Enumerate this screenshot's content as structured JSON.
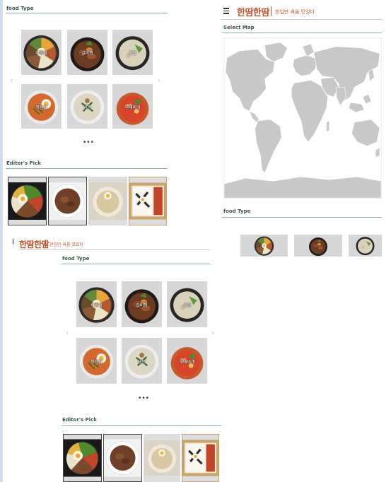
{
  "panel_left": {
    "food_type_title": "food Type",
    "foods": [
      {
        "label": "비빔밥",
        "icon": "bibimbap-icon"
      },
      {
        "label": "갈비찜",
        "icon": "galbijjim-icon"
      },
      {
        "label": "국밥",
        "icon": "gukbap-icon"
      },
      {
        "label": "볶음밥",
        "icon": "fried-rice-icon"
      },
      {
        "label": "냉면",
        "icon": "naengmyeon-icon"
      },
      {
        "label": "부대찌개",
        "icon": "budae-jjigae-icon"
      }
    ],
    "prev_arrow": "‹",
    "next_arrow": "›",
    "pager_dots": "•••",
    "editors_pick_title": "Editor's Pick"
  },
  "panel_right": {
    "menu_icon": "hamburger-menu-icon",
    "logo": "한땀한땀",
    "tagline": "한입만 싸움 맛있다",
    "select_map_title": "Select Map",
    "map_icon": "world-map-icon",
    "food_type_title": "food Type"
  },
  "panel_bottom": {
    "logo": "한땀한땀",
    "tagline": "한입만 싸움 맛있다",
    "food_type_title": "food Type",
    "foods": [
      {
        "label": "비빔밥"
      },
      {
        "label": "갈비찜"
      },
      {
        "label": "국밥"
      },
      {
        "label": "볶음밥"
      },
      {
        "label": "냉면"
      },
      {
        "label": "부대찌개"
      }
    ],
    "prev_arrow": "‹",
    "next_arrow": "›",
    "pager_dots": "•••",
    "editors_pick_title": "Editor's Pick"
  },
  "colors": {
    "accent": "#c0532d",
    "section_rule": "#8fb59b",
    "thumb_bg": "#d7d7d7",
    "map_land": "#c8c8c8"
  }
}
